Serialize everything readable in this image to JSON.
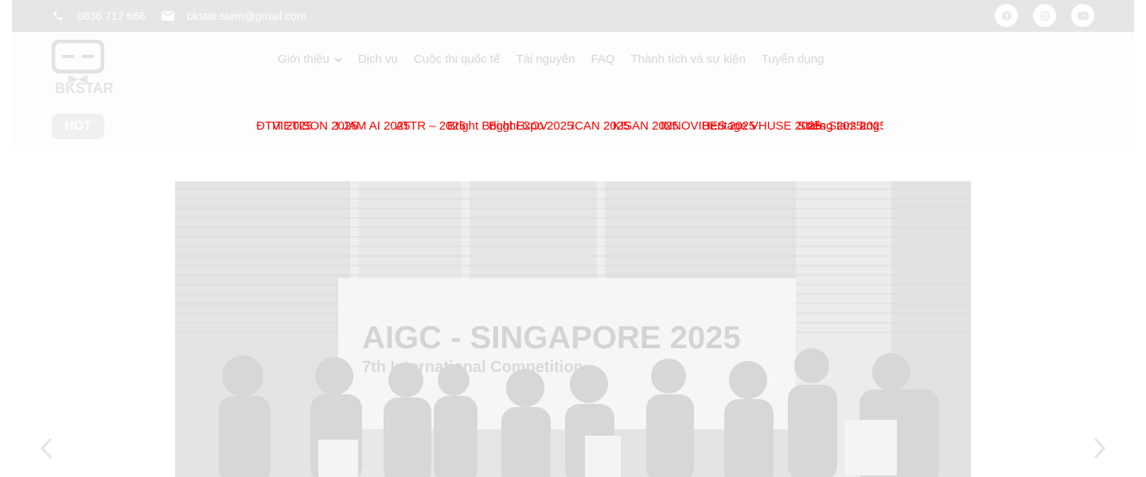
{
  "topbar": {
    "phone": "0836 717 666",
    "email": "bkstar.stem@gmail.com",
    "socials": [
      {
        "icon": "facebook-icon"
      },
      {
        "icon": "instagram-icon"
      },
      {
        "icon": "youtube-icon"
      }
    ]
  },
  "logo": {
    "text": "BKSTAR"
  },
  "nav": {
    "items": [
      {
        "label": "Giới thiệu",
        "dropdown": true
      },
      {
        "label": "Dịch vụ"
      },
      {
        "label": "Cuộc thi quốc tế"
      },
      {
        "label": "Tài nguyên"
      },
      {
        "label": "FAQ"
      },
      {
        "label": "Thành tích và sự kiện"
      },
      {
        "label": "Tuyển dụng"
      }
    ]
  },
  "hot": {
    "badge": "HOT",
    "items": [
      "ĐTIT 2025",
      "VIETISON 2025",
      "I JAM AI 2025",
      "ATTR – 2025",
      "Bright Bright Expo 2025",
      "Bị ghi COV",
      "ICAN 2025",
      "KISAN 2025",
      "INNOVIBES 2025",
      "Heritage VHUSE 2025",
      "Stars Stars 2025",
      "tiếng 2025",
      "ang 202"
    ]
  },
  "slider": {
    "banner_title": "AIGC - SINGAPORE 2025",
    "banner_subtitle": "7th International Competition"
  },
  "colors": {
    "topbar_bg": "#e6e6e6",
    "ticker_text": "#ff0000",
    "nav_text": "#d6d6d6"
  }
}
